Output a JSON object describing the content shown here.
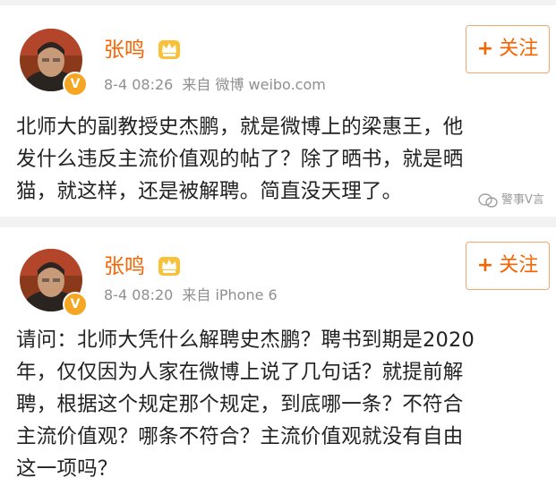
{
  "colors": {
    "username": "#f86300",
    "meta_gray": "#8f8f8f",
    "body_text": "#222222",
    "follow_border": "#f0a870",
    "vip_badge": "#f5a623",
    "divider": "#f2f2f2"
  },
  "posts": [
    {
      "username": "张鸣",
      "crown_icon": "crown-vip-icon",
      "verified_icon": "verified-v-icon",
      "time": "8-4 08:26",
      "source_prefix": "来自",
      "source": "微博 weibo.com",
      "follow_plus": "+",
      "follow_label": "关注",
      "lines": [
        "北师大的副教授史杰鹏，就是微博上的梁惠王，他",
        "发什么违反主流价值观的帖了？除了晒书，就是晒",
        "猫，就这样，还是被解聘。简直没天理了。"
      ]
    },
    {
      "username": "张鸣",
      "crown_icon": "crown-vip-icon",
      "verified_icon": "verified-v-icon",
      "time": "8-4 08:20",
      "source_prefix": "来自",
      "source": "iPhone 6",
      "follow_plus": "+",
      "follow_label": "关注",
      "lines": [
        "请问：北师大凭什么解聘史杰鹏？聘书到期是2020",
        "年，仅仅因为人家在微博上说了几句话？就提前解",
        "聘，根据这个规定那个规定，到底哪一条？不符合",
        "主流价值观？哪条不符合？主流价值观就没有自由",
        "这一项吗？"
      ]
    }
  ],
  "watermark": {
    "icon": "wechat-bubble-icon",
    "text": "警事V言"
  }
}
